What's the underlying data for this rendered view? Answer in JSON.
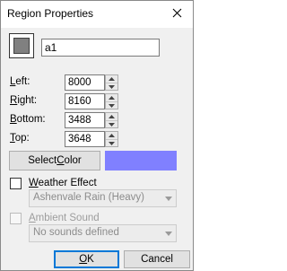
{
  "window": {
    "title": "Region Properties",
    "close_icon": "close-icon"
  },
  "region": {
    "name": "a1"
  },
  "bounds": [
    {
      "label_accel": "L",
      "label_rest": "eft:",
      "value": "8000"
    },
    {
      "label_accel": "R",
      "label_rest": "ight:",
      "value": "8160"
    },
    {
      "label_accel": "B",
      "label_rest": "ottom:",
      "value": "3488"
    },
    {
      "label_accel": "T",
      "label_rest": "op:",
      "value": "3648"
    }
  ],
  "color": {
    "button_accel": "C",
    "button_prefix": "Select ",
    "button_suffix": "olor",
    "value": "#8080ff"
  },
  "weather": {
    "label_accel": "W",
    "label_rest": "eather Effect",
    "checked": false,
    "selected": "Ashenvale Rain (Heavy)"
  },
  "ambient": {
    "label_accel": "A",
    "label_rest": "mbient Sound",
    "checked": false,
    "enabled": false,
    "selected": "No sounds defined"
  },
  "buttons": {
    "ok_accel": "O",
    "ok_rest": "K",
    "cancel": "Cancel"
  }
}
